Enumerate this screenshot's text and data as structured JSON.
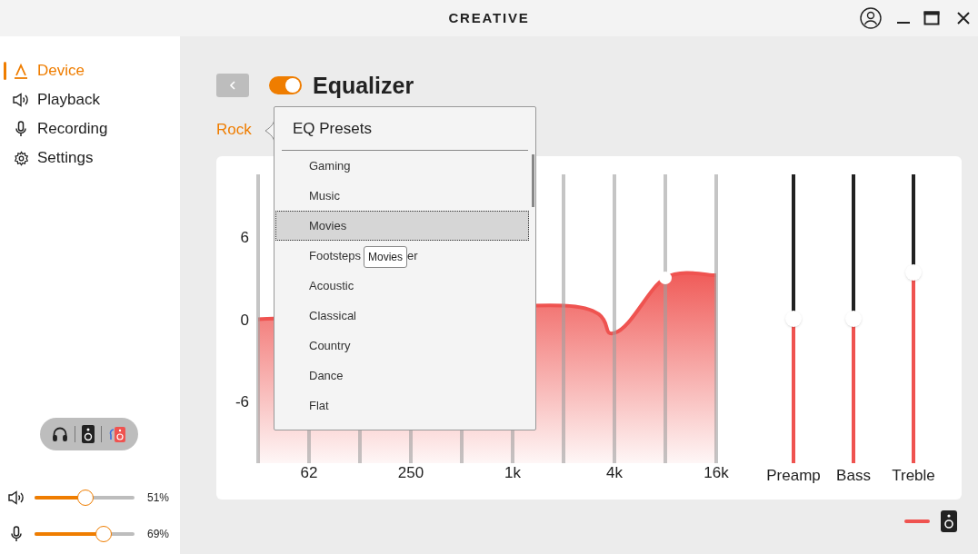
{
  "window": {
    "logo": "CREATIVE"
  },
  "sidebar": {
    "items": [
      {
        "kind": "device",
        "label": "Device",
        "selected": true
      },
      {
        "kind": "playback",
        "label": "Playback",
        "selected": false
      },
      {
        "kind": "recording",
        "label": "Recording",
        "selected": false
      },
      {
        "kind": "settings",
        "label": "Settings",
        "selected": false
      }
    ]
  },
  "volume": [
    {
      "kind": "speaker",
      "level": 0.51,
      "reading": "51%"
    },
    {
      "kind": "mic",
      "level": 0.69,
      "reading": "69%"
    }
  ],
  "equalizer": {
    "title": "Equalizer",
    "on": true,
    "preset": "Rock",
    "chart_data": {
      "type": "line",
      "categories": [
        null,
        "62",
        null,
        "250",
        null,
        "1k",
        null,
        "4k",
        null,
        "16k"
      ],
      "series": [
        {
          "color": "#ef5350",
          "values": [
            0,
            null,
            null,
            null,
            null,
            null,
            1,
            -1,
            3,
            3.2
          ]
        }
      ],
      "ylim": [
        -13.1,
        11.85
      ],
      "yticks": [
        -6,
        0,
        6
      ]
    },
    "bands": [
      {
        "selected": false
      },
      {
        "selected": false
      },
      {
        "selected": false
      },
      {
        "selected": false
      },
      {
        "selected": false
      },
      {
        "selected": false
      },
      {
        "selected": false
      },
      {
        "selected": false
      },
      {
        "selected": true
      },
      {
        "selected": false
      }
    ],
    "sliders": [
      {
        "label": "Preamp",
        "level": 0.5
      },
      {
        "label": "Bass",
        "level": 0.5
      },
      {
        "label": "Treble",
        "level": 0.66
      }
    ]
  },
  "presets_popup": {
    "title": "EQ Presets",
    "items": [
      {
        "label": "Gaming",
        "selected": false
      },
      {
        "label": "Music",
        "selected": false
      },
      {
        "label": "Movies",
        "selected": true
      },
      {
        "label": "Footsteps",
        "visible_tail": "er",
        "selected": false
      },
      {
        "label": "Acoustic",
        "selected": false
      },
      {
        "label": "Classical",
        "selected": false
      },
      {
        "label": "Country",
        "selected": false
      },
      {
        "label": "Dance",
        "selected": false
      },
      {
        "label": "Flat",
        "selected": false
      }
    ],
    "tooltip": "Movies"
  }
}
